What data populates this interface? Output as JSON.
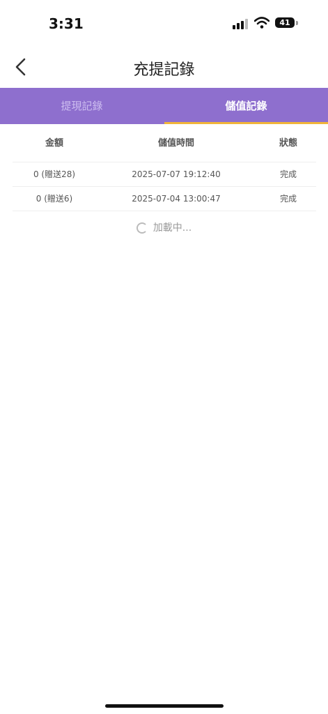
{
  "status_bar": {
    "time": "3:31",
    "battery": "41"
  },
  "nav": {
    "title": "充提記錄"
  },
  "tabs": [
    {
      "label": "提現記錄",
      "active": false
    },
    {
      "label": "儲值記錄",
      "active": true
    }
  ],
  "table": {
    "headers": {
      "amount": "金額",
      "time": "儲值時間",
      "status": "狀態"
    },
    "rows": [
      {
        "amount": "0 (贈送28)",
        "time": "2025-07-07 19:12:40",
        "status": "完成"
      },
      {
        "amount": "0 (贈送6)",
        "time": "2025-07-04 13:00:47",
        "status": "完成"
      }
    ]
  },
  "loading_text": "加載中...",
  "colors": {
    "tab_bar": "#8e6fce",
    "tab_indicator": "#f0b43a"
  }
}
